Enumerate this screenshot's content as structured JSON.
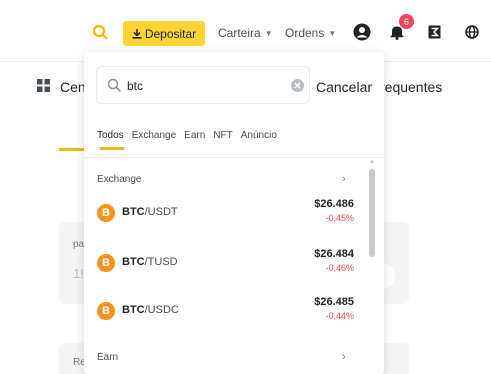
{
  "nav": {
    "deposit_label": "Depositar",
    "wallet_label": "Carteira",
    "orders_label": "Ordens",
    "notification_count": "6",
    "accent_color": "#fcd535"
  },
  "background": {
    "left_title": "Cen",
    "right_title": "requentes",
    "card1_label": "pa",
    "card1_value": "1!",
    "card2_label": "Re"
  },
  "search": {
    "query": "btc",
    "cancel_label": "Cancelar",
    "tabs": [
      {
        "label": "Todos",
        "active": true
      },
      {
        "label": "Exchange",
        "active": false
      },
      {
        "label": "Earn",
        "active": false
      },
      {
        "label": "NFT",
        "active": false
      },
      {
        "label": "Anúncio",
        "active": false
      }
    ],
    "sections": {
      "exchange": "Exchange",
      "earn": "Earn"
    },
    "pairs": [
      {
        "base": "BTC",
        "quote": "/USDT",
        "price": "$26.486",
        "change": "-0,45%"
      },
      {
        "base": "BTC",
        "quote": "/TUSD",
        "price": "$26.484",
        "change": "-0,46%"
      },
      {
        "base": "BTC",
        "quote": "/USDC",
        "price": "$26.485",
        "change": "-0,44%"
      }
    ]
  },
  "icons": {
    "coin_glyph": "B",
    "chevron": "›",
    "caret": "▼"
  },
  "colors": {
    "brand": "#f0b90b",
    "negative": "#f6465d",
    "coin": "#f7931a"
  }
}
